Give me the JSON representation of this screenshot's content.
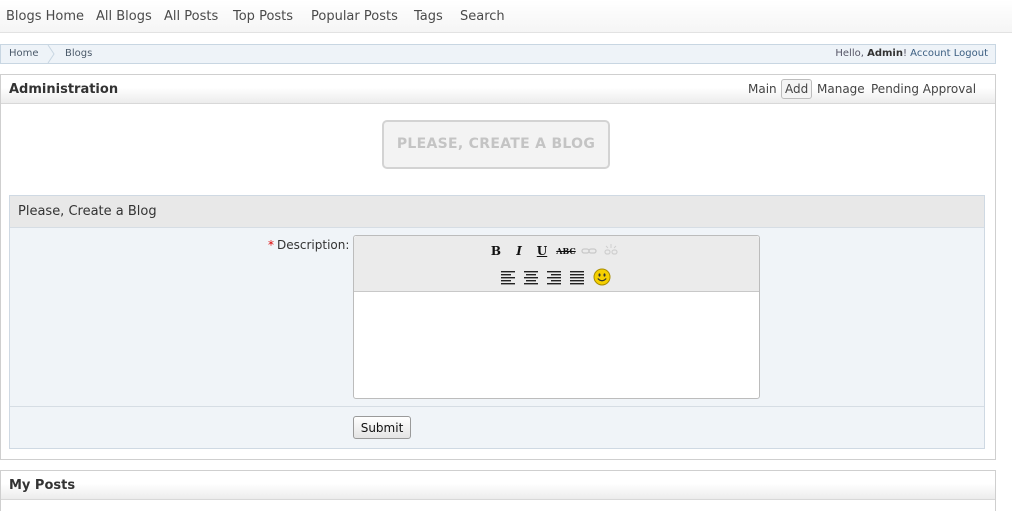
{
  "topnav": {
    "items": [
      "Blogs Home",
      "All Blogs",
      "All Posts",
      "Top Posts",
      "Popular Posts",
      "Tags",
      "Search"
    ]
  },
  "breadcrumb": {
    "items": [
      "Home",
      "Blogs"
    ],
    "greeting_prefix": "Hello, ",
    "user": "Admin",
    "greeting_suffix": "!",
    "account_link": "Account",
    "logout_link": "Logout"
  },
  "admin_panel": {
    "title": "Administration",
    "tabs": [
      "Main",
      "Add",
      "Manage",
      "Pending Approval"
    ],
    "active_tab": "Add",
    "create_button": "PLEASE, CREATE A BLOG"
  },
  "form": {
    "title": "Please, Create a Blog",
    "required_mark": "*",
    "description_label": "Description:",
    "submit_label": "Submit",
    "toolbar": {
      "bold": "B",
      "italic": "I",
      "underline": "U",
      "strikethrough": "ABC"
    }
  },
  "posts_panel": {
    "title": "My Posts"
  },
  "colors": {
    "link": "#3a5d80",
    "required": "#dd0000",
    "smiley": "#f5d000"
  }
}
